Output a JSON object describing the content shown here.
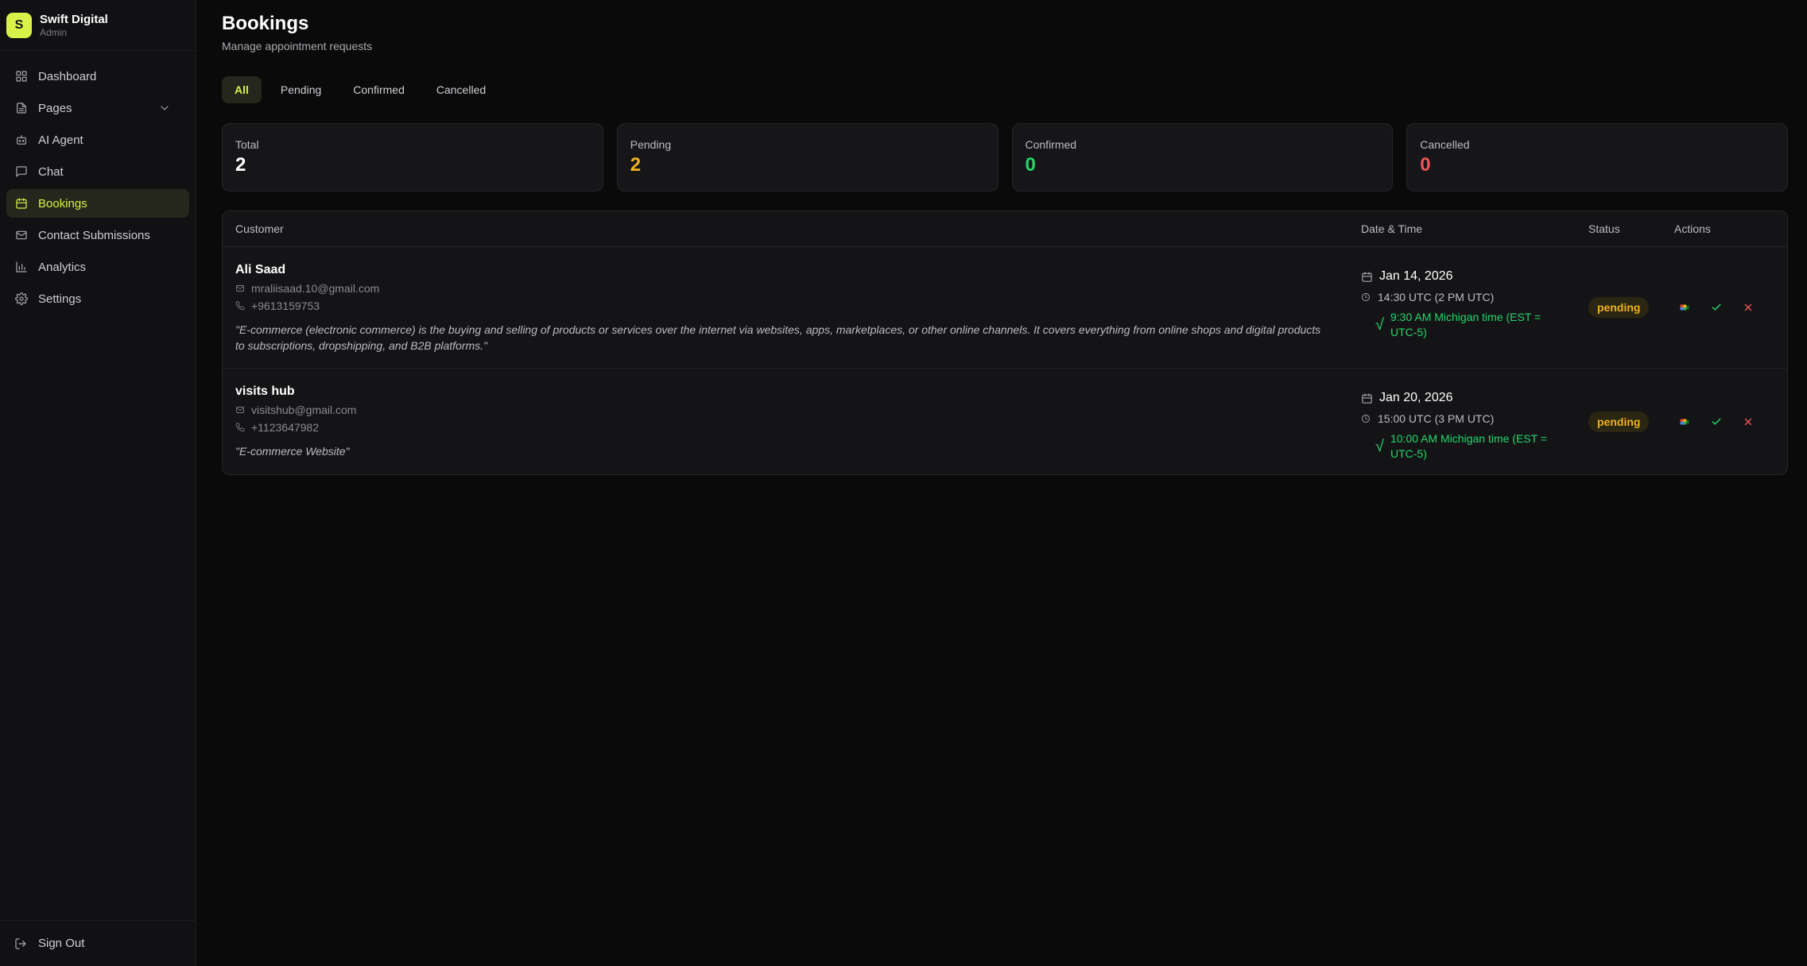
{
  "brand": {
    "logo_letter": "S",
    "name": "Swift Digital",
    "role": "Admin"
  },
  "sidebar": {
    "items": [
      {
        "label": "Dashboard",
        "icon": "grid-icon"
      },
      {
        "label": "Pages",
        "icon": "file-icon"
      },
      {
        "label": "AI Agent",
        "icon": "bot-icon"
      },
      {
        "label": "Chat",
        "icon": "chat-icon"
      },
      {
        "label": "Bookings",
        "icon": "calendar-icon",
        "active": true
      },
      {
        "label": "Contact Submissions",
        "icon": "mail-icon"
      },
      {
        "label": "Analytics",
        "icon": "bar-chart-icon"
      },
      {
        "label": "Settings",
        "icon": "gear-icon"
      }
    ],
    "signout": "Sign Out"
  },
  "page": {
    "title": "Bookings",
    "subtitle": "Manage appointment requests"
  },
  "tabs": [
    "All",
    "Pending",
    "Confirmed",
    "Cancelled"
  ],
  "stats": [
    {
      "label": "Total",
      "value": "2",
      "color": "#ffffff"
    },
    {
      "label": "Pending",
      "value": "2",
      "color": "#f0b21b"
    },
    {
      "label": "Confirmed",
      "value": "0",
      "color": "#24d66c"
    },
    {
      "label": "Cancelled",
      "value": "0",
      "color": "#f0545a"
    }
  ],
  "table": {
    "headers": [
      "Customer",
      "Date & Time",
      "Status",
      "Actions"
    ],
    "rows": [
      {
        "name": "Ali Saad",
        "email": "mraliisaad.10@gmail.com",
        "phone": "+9613159753",
        "note": "\"E-commerce (electronic commerce) is the buying and selling of products or services over the internet via websites, apps, marketplaces, or other online channels. It covers everything from online shops and digital products to subscriptions, dropshipping, and B2B platforms.\"",
        "date": "Jan 14, 2026",
        "time": "14:30 UTC (2 PM UTC)",
        "local_check": "√",
        "local": "9:30 AM Michigan time (EST = UTC-5)",
        "status": "pending"
      },
      {
        "name": "visits hub",
        "email": "visitshub@gmail.com",
        "phone": "+1123647982",
        "note": "\"E-commerce Website\"",
        "date": "Jan 20, 2026",
        "time": "15:00 UTC (3 PM UTC)",
        "local_check": "√",
        "local": "10:00 AM Michigan time (EST = UTC-5)",
        "status": "pending"
      }
    ]
  },
  "colors": {
    "accent": "#d9f24a",
    "pending": "#f0b21b",
    "confirmed": "#24d66c",
    "cancelled": "#f0545a"
  }
}
